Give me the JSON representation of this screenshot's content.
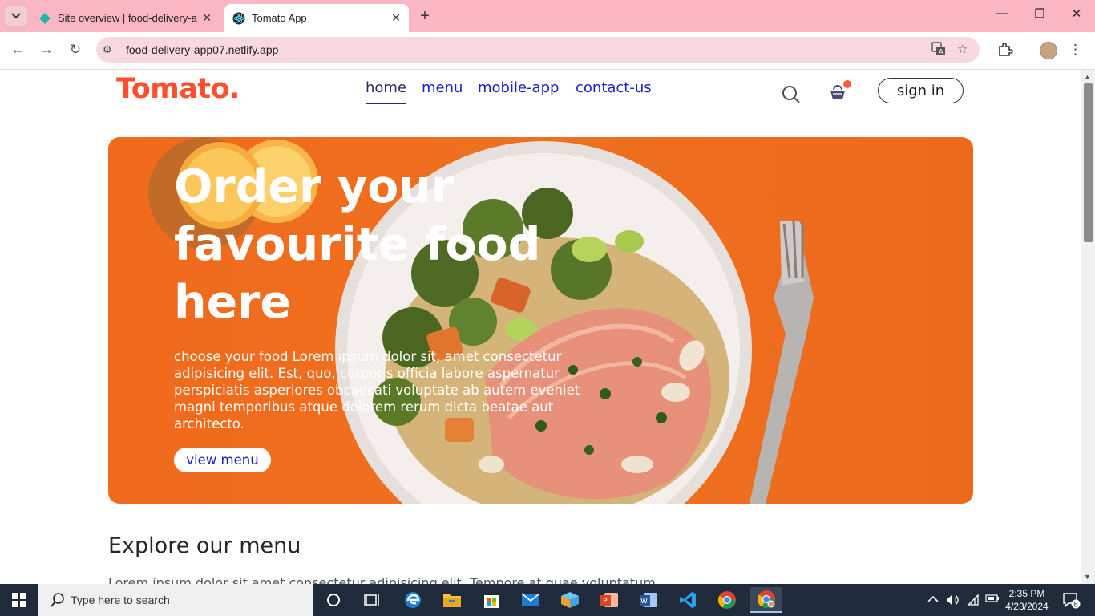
{
  "browser": {
    "tabs": [
      {
        "title": "Site overview | food-delivery-a",
        "active": false
      },
      {
        "title": "Tomato App",
        "active": true
      }
    ],
    "new_tab": "+",
    "url": "food-delivery-app07.netlify.app",
    "window_controls": {
      "minimize": "—",
      "restore": "❐",
      "close": "✕"
    }
  },
  "page": {
    "logo": "Tomato.",
    "nav": [
      "home",
      "menu",
      "mobile-app",
      "contact-us"
    ],
    "active_nav": "home",
    "sign_in": "sign in",
    "cart_has_items": true,
    "hero": {
      "title": "Order your favourite food here",
      "text": "choose your food Lorem ipsum dolor sit, amet consectetur adipisicing elit. Est, quo, corporis officia labore aspernatur perspiciatis asperiores obcaecati voluptate ab autem eveniet magni temporibus atque dolorem rerum dicta beatae aut architecto.",
      "button": "view menu"
    },
    "explore_title": "Explore our menu",
    "explore_text": "Lorem ipsum dolor sit amet consectetur adipisicing elit. Tempore at quae voluptatum"
  },
  "taskbar": {
    "search_placeholder": "Type here to search",
    "time": "2:35 PM",
    "date": "4/23/2024",
    "notification_count": "8"
  },
  "colors": {
    "accent": "#ff4f2c",
    "hero_bg": "#ef6e1f",
    "tab_bar": "#fbb6c4",
    "link": "#2020c8"
  }
}
